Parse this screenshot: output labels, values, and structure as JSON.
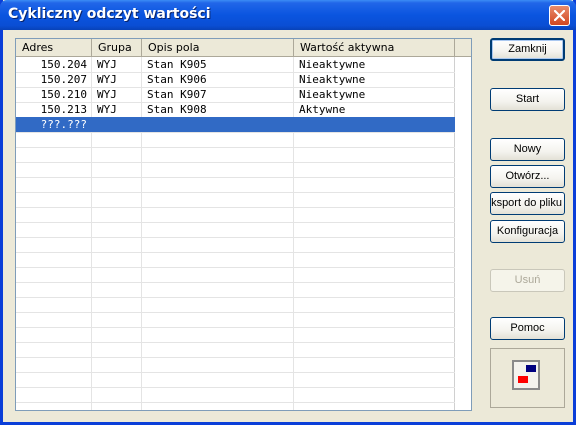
{
  "window": {
    "title": "Cykliczny odczyt wartości"
  },
  "list": {
    "columns": [
      "Adres",
      "Grupa",
      "Opis pola",
      "Wartość aktywna"
    ],
    "rows": [
      {
        "adres": "150.204",
        "grupa": "WYJ",
        "opis": "Stan K905",
        "wartosc": "Nieaktywne"
      },
      {
        "adres": "150.207",
        "grupa": "WYJ",
        "opis": "Stan K906",
        "wartosc": "Nieaktywne"
      },
      {
        "adres": "150.210",
        "grupa": "WYJ",
        "opis": "Stan K907",
        "wartosc": "Nieaktywne"
      },
      {
        "adres": "150.213",
        "grupa": "WYJ",
        "opis": "Stan K908",
        "wartosc": "Aktywne"
      },
      {
        "adres": "???.???",
        "grupa": "",
        "opis": "",
        "wartosc": ""
      }
    ],
    "selected_row": 4
  },
  "buttons": {
    "zamknij": "Zamknij",
    "start": "Start",
    "nowy": "Nowy",
    "otworz": "Otwórz...",
    "eksport": "ksport do pliku",
    "konfiguracja": "Konfiguracja",
    "usun": "Usuń",
    "pomoc": "Pomoc"
  },
  "icons": {
    "close": "close-icon",
    "status": "status-indicator-icon"
  },
  "colors": {
    "titlebar": "#0a55e0",
    "selection": "#316ac5",
    "indicator_top": "#000080",
    "indicator_bottom": "#ff0000"
  }
}
